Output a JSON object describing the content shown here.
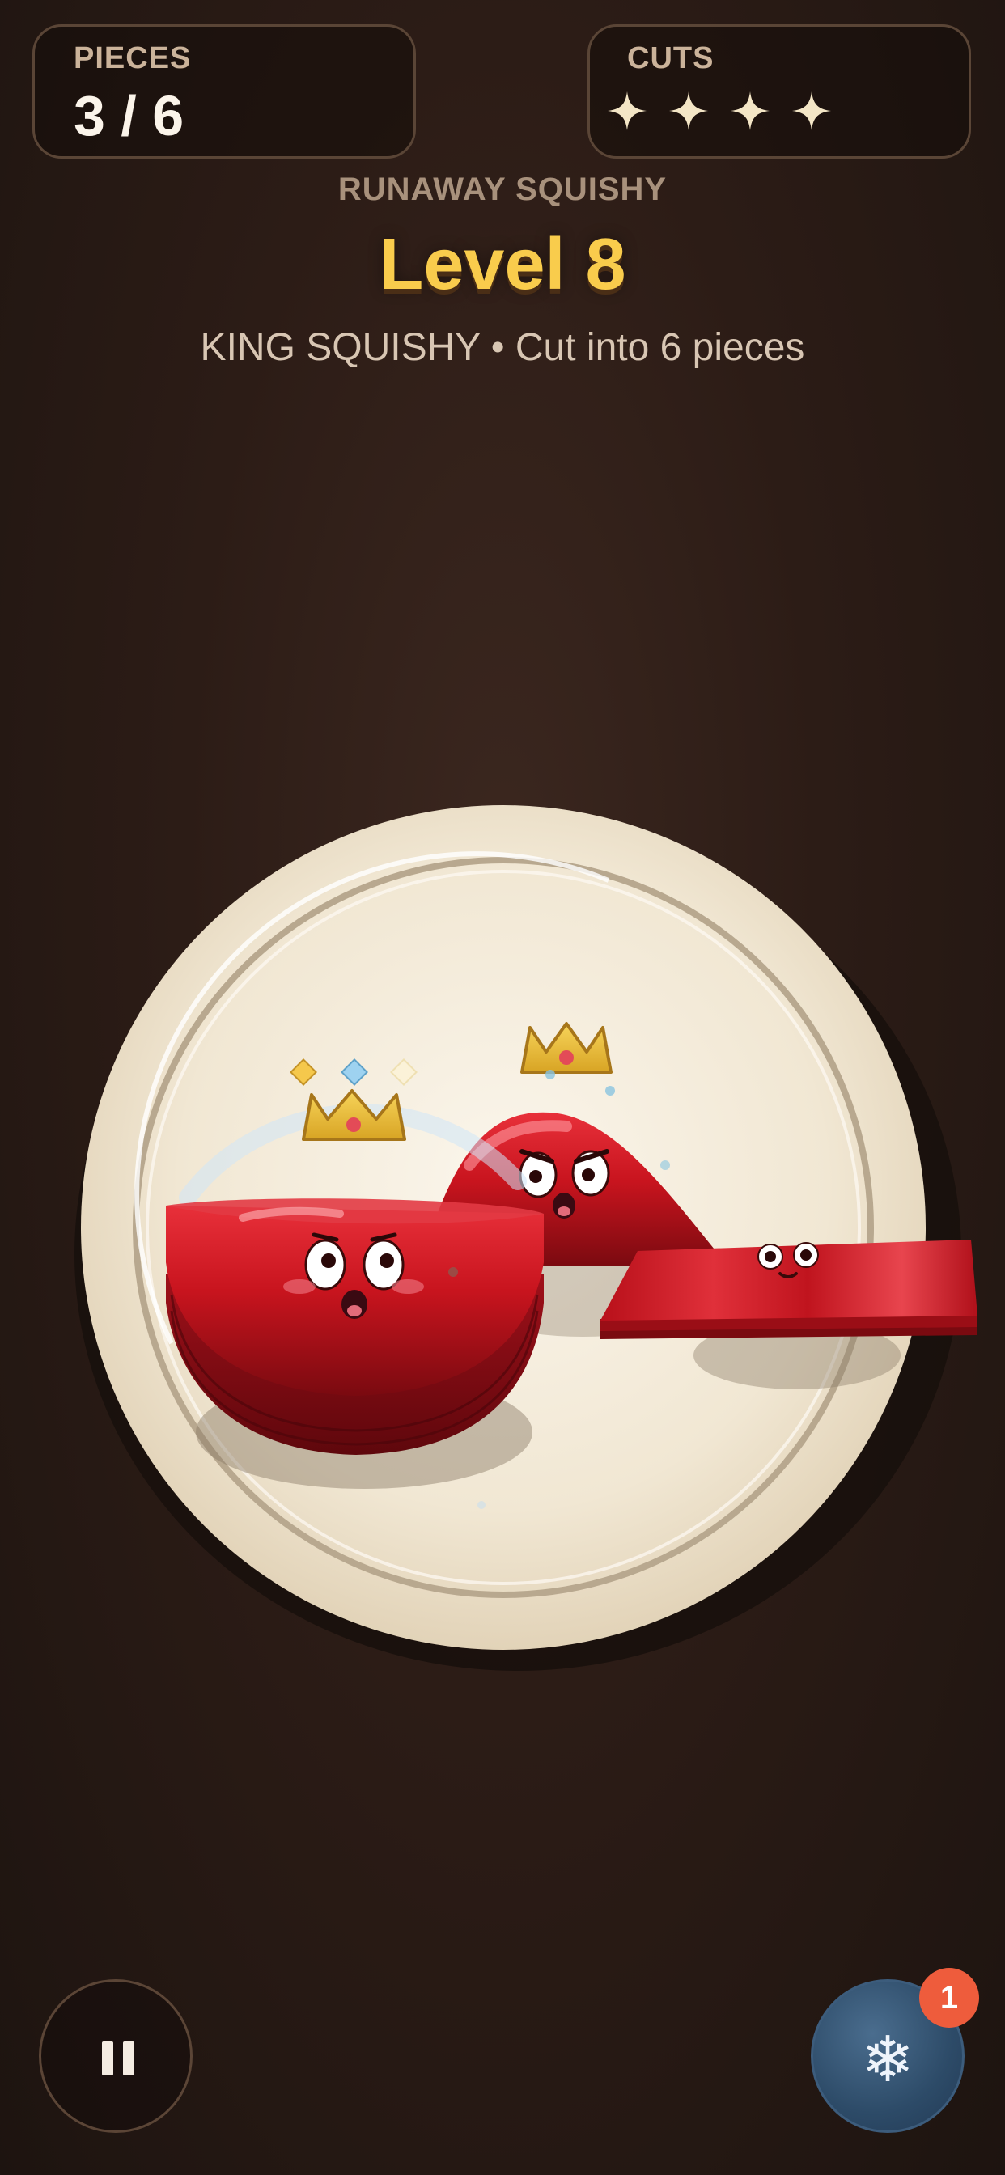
{
  "hud": {
    "pieces": {
      "label": "PIECES",
      "value": "3 / 6",
      "current": 3,
      "total": 6
    },
    "cuts": {
      "label": "CUTS",
      "stars": 4,
      "star_color": "#f4e6c6"
    }
  },
  "header": {
    "subtitle": "RUNAWAY SQUISHY",
    "title": "Level 8",
    "description": "KING SQUISHY • Cut into 6 pieces",
    "title_color": "#f9cc4c"
  },
  "scene": {
    "plate_color": "#f1e7d3",
    "jelly_color": "#c8141e",
    "crown_color": "#f2c23a",
    "pieces": [
      {
        "name": "dome-piece",
        "mood": "worried",
        "crowned": true
      },
      {
        "name": "peak-piece",
        "mood": "angry",
        "crowned": true
      },
      {
        "name": "slab-piece",
        "mood": "smiling",
        "crowned": false
      }
    ]
  },
  "controls": {
    "pause_icon": "pause-icon",
    "freeze_icon": "snowflake-icon",
    "freeze_glyph": "❄",
    "freeze_count": "1"
  }
}
